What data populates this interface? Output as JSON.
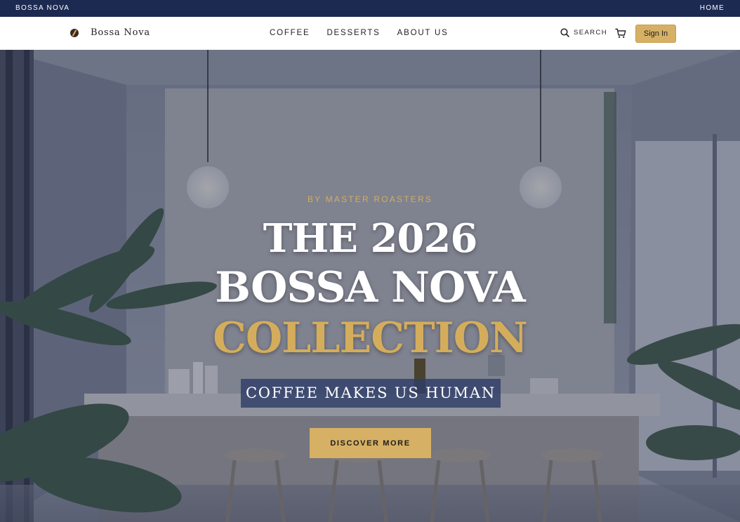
{
  "topbar": {
    "brand": "BOSSA NOVA",
    "home_link": "HOME"
  },
  "nav": {
    "logo_text": "Bossa Nova",
    "menu": [
      "COFFEE",
      "DESSERTS",
      "ABOUT US"
    ],
    "search_label": "SEARCH",
    "sign_in_label": "Sign In"
  },
  "hero": {
    "eyebrow": "BY MASTER ROASTERS",
    "title_line1": "THE 2026",
    "title_line2": "BOSSA NOVA",
    "title_line3": "COLLECTION",
    "tagline": "COFFEE MAKES US HUMAN",
    "cta_label": "DISCOVER MORE"
  },
  "colors": {
    "topbar": "#1c2a52",
    "accent_gold": "#d6b065",
    "tagline_bg": "#303e68"
  },
  "icons": [
    "coffee-bean-icon",
    "search-icon",
    "cart-icon"
  ]
}
